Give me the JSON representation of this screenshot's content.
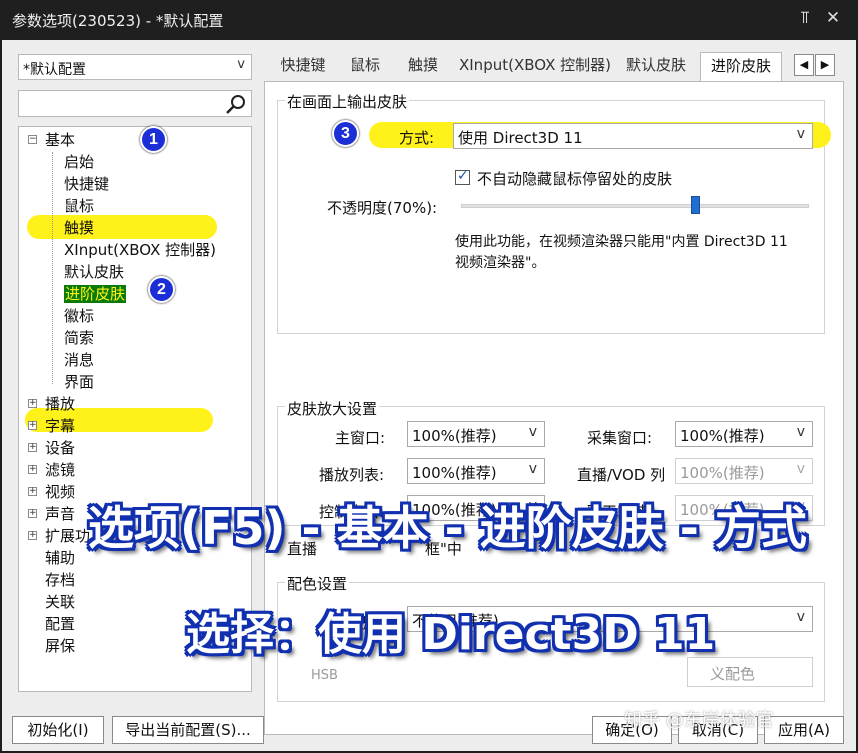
{
  "window": {
    "title": "参数选项(230523) - *默认配置",
    "pin_icon": "pin-icon",
    "close_icon": "close-icon"
  },
  "left": {
    "profile_value": "*默认配置",
    "search_placeholder": "",
    "tree": {
      "basic": "基本",
      "basic_children": [
        "启始",
        "快捷键",
        "鼠标",
        "触摸",
        "XInput(XBOX 控制器)",
        "默认皮肤",
        "进阶皮肤",
        "徽标",
        "简索",
        "消息",
        "界面"
      ],
      "collapsed": [
        "播放",
        "字幕",
        "设备",
        "滤镜",
        "视频",
        "声音",
        "扩展功"
      ],
      "leaves": [
        "辅助",
        "存档",
        "关联",
        "配置",
        "屏保"
      ]
    }
  },
  "tabs": [
    "快捷键",
    "鼠标",
    "触摸",
    "XInput(XBOX 控制器)",
    "默认皮肤",
    "进阶皮肤"
  ],
  "active_tab": "进阶皮肤",
  "output_group": {
    "title": "在画面上输出皮肤",
    "mode_label": "方式:",
    "mode_value": "使用 Direct3D 11",
    "checkbox_label": "不自动隐藏鼠标停留处的皮肤",
    "checkbox_checked": true,
    "opacity_label": "不透明度(70%):",
    "opacity_value": 0.7,
    "note_line1": "使用此功能，在视频渲染器只能用\"内置 Direct3D 11",
    "note_line2": "视频渲染器\"。"
  },
  "zoom_group": {
    "title": "皮肤放大设置",
    "rows": [
      {
        "label": "主窗口:",
        "value": "100%(推荐)",
        "label2": "采集窗口:",
        "value2": "100%(推荐)",
        "disabled2": false
      },
      {
        "label": "播放列表:",
        "value": "100%(推荐)",
        "label2": "直播/VOD 列",
        "value2": "100%(推荐)",
        "disabled2": true
      },
      {
        "label": "控制窗口:",
        "value": "100%(推荐)",
        "label2": "聊天区域:",
        "value2": "100%(推荐)",
        "disabled2": true
      }
    ]
  },
  "partial_text": {
    "live_left": "直播",
    "live_right": "框\"中",
    "color_group": "配色设置"
  },
  "color_group": {
    "color_label": "配色:",
    "color_value": "不使用(推荐)",
    "hsb": "HSB",
    "custom": "义配色"
  },
  "buttons": {
    "reset": "初始化(I)",
    "export": "导出当前配置(S)...",
    "ok": "确定(O)",
    "cancel": "取消(C)",
    "apply": "应用(A)"
  },
  "overlay": {
    "line1": "选项(F5) - 基本 - 进阶皮肤 - 方式",
    "line2": "选择：使用 Direct3D 11",
    "watermark": "知乎 @东岸体验官"
  },
  "badges": [
    "1",
    "2",
    "3"
  ],
  "colors": {
    "highlight": "#fff21a",
    "badge": "#1c2fd6",
    "selected_bg": "#0a7a0a",
    "overlay_stroke": "#1030b0"
  }
}
